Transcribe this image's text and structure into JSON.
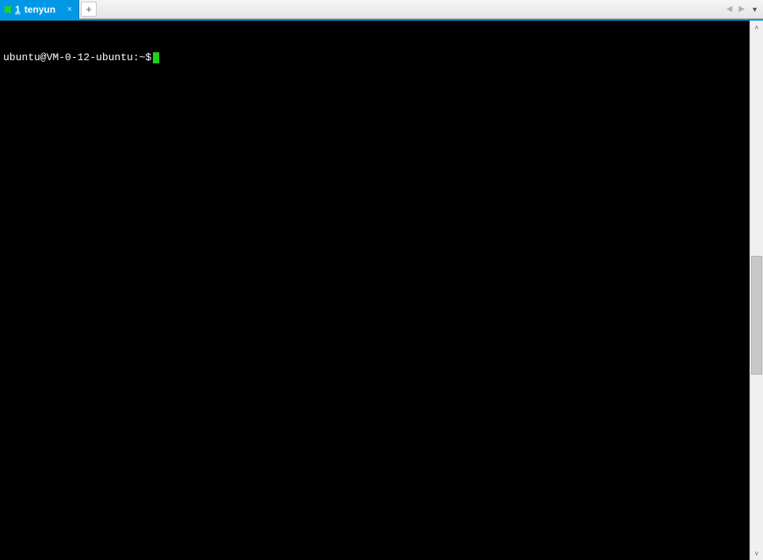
{
  "tab": {
    "number": "1",
    "title": "tenyun",
    "close_glyph": "×"
  },
  "newtab_glyph": "+",
  "tabbar_nav": {
    "prev": "◀",
    "next": "▶",
    "menu": "▼"
  },
  "terminal": {
    "prompt": "ubuntu@VM-0-12-ubuntu:~$"
  },
  "scrollbar": {
    "up": "˄",
    "down": "˅"
  }
}
